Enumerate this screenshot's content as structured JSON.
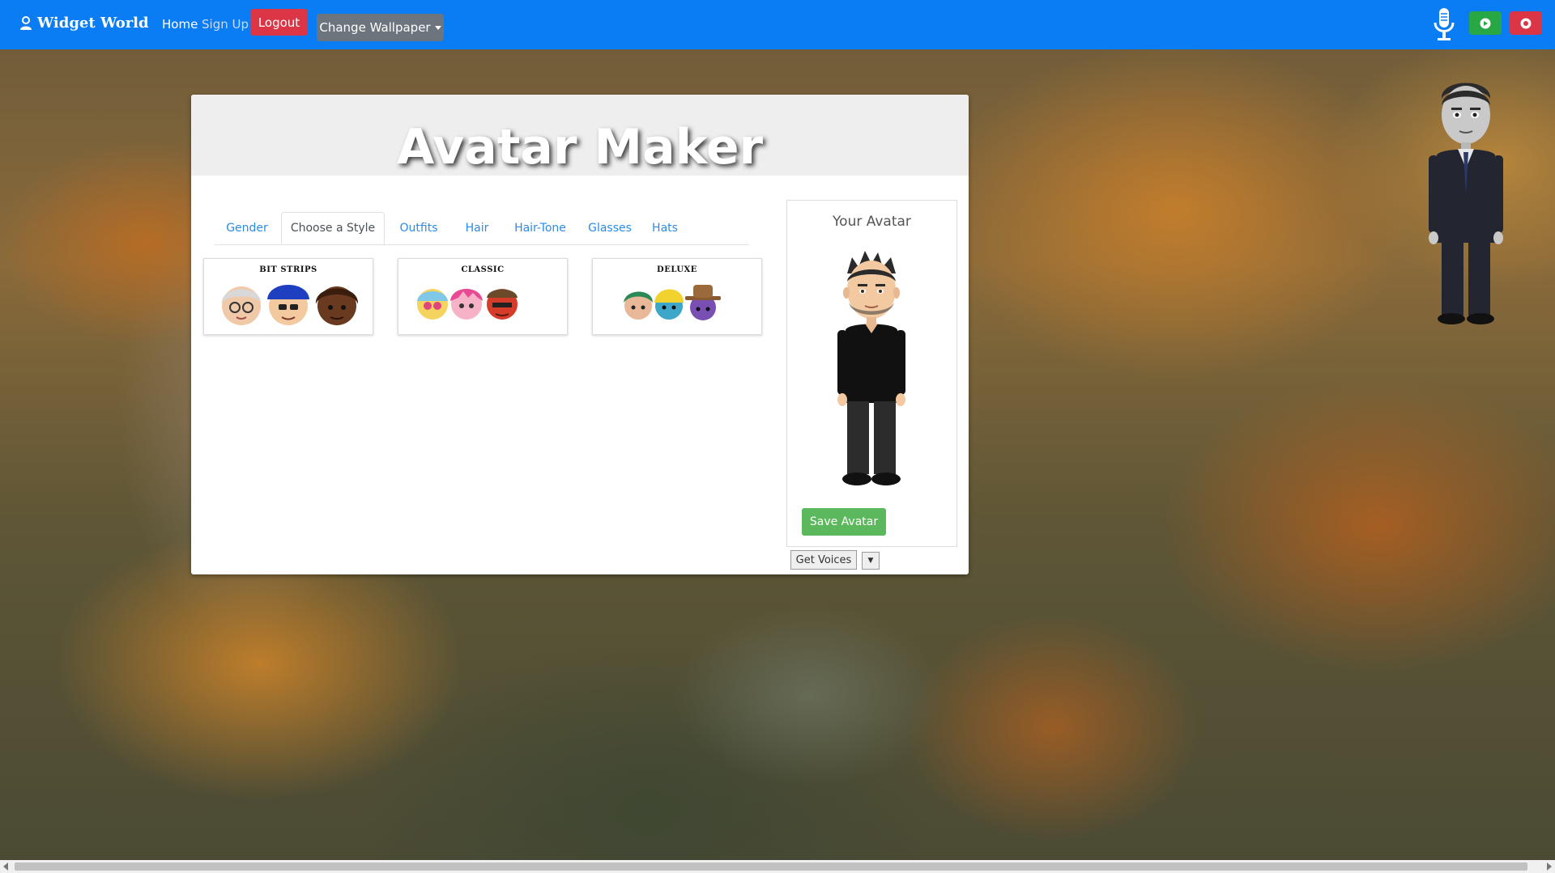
{
  "navbar": {
    "brand": "Widget World",
    "home": "Home",
    "signup": "Sign Up",
    "logout": "Logout",
    "wallpaper": "Change Wallpaper",
    "colors": {
      "bar": "#0a7df4",
      "logout": "#dc3545",
      "play": "#28a745",
      "record": "#dc3545"
    }
  },
  "card": {
    "title": "Avatar Maker",
    "tabs": [
      "Gender",
      "Choose a Style",
      "Outfits",
      "Hair",
      "Hair-Tone",
      "Glasses",
      "Hats"
    ],
    "active_tab": "Choose a Style",
    "styles": [
      {
        "label": "BIT STRIPS"
      },
      {
        "label": "CLASSIC"
      },
      {
        "label": "DELUXE"
      }
    ]
  },
  "avatar_panel": {
    "title": "Your Avatar",
    "save": "Save Avatar",
    "save_color": "#5cb85c"
  },
  "voices": {
    "button": "Get Voices",
    "dropdown": "▼"
  },
  "icons": [
    "user-icon",
    "microphone-icon",
    "play-icon",
    "record-icon"
  ]
}
